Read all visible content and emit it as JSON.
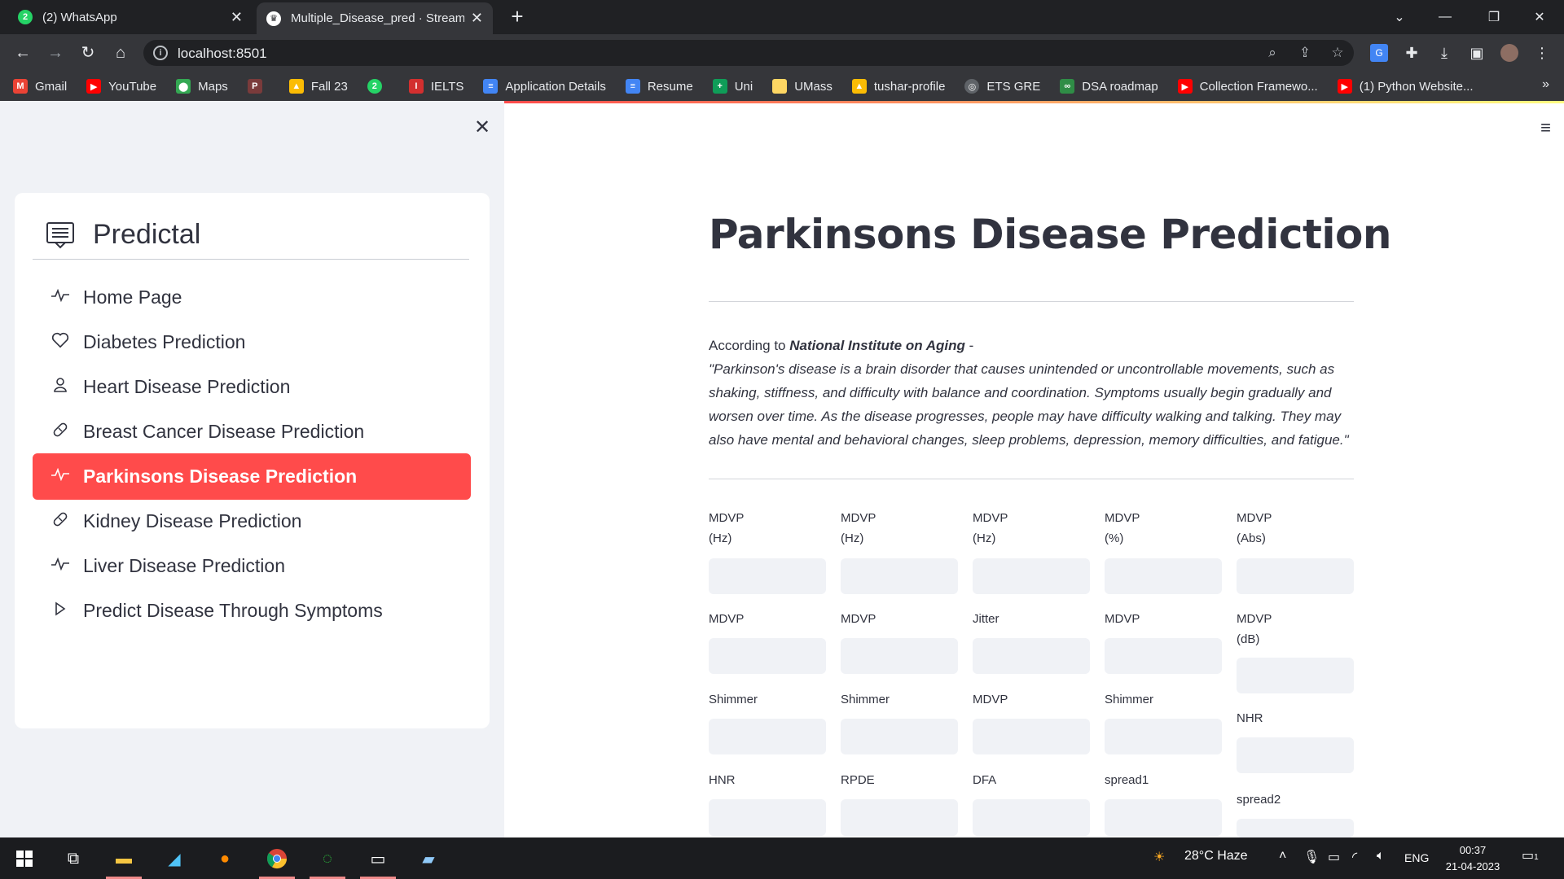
{
  "browser": {
    "tabs": [
      {
        "title": "(2) WhatsApp",
        "icon": "whatsapp-icon",
        "active": false
      },
      {
        "title": "Multiple_Disease_pred · Streamlit",
        "icon": "streamlit-icon",
        "active": true
      }
    ],
    "url": "localhost:8501",
    "bookmarks": [
      {
        "label": "Gmail",
        "icon": "gmail-icon",
        "color": "#ea4335"
      },
      {
        "label": "YouTube",
        "icon": "youtube-icon",
        "color": "#ff0000"
      },
      {
        "label": "Maps",
        "icon": "maps-icon",
        "color": "#34a853"
      },
      {
        "label": "",
        "icon": "pr-icon",
        "color": "#c0392b"
      },
      {
        "label": "Fall 23",
        "icon": "drive-icon",
        "color": "#fbbc04"
      },
      {
        "label": "",
        "icon": "whatsapp-icon",
        "color": "#25d366"
      },
      {
        "label": "IELTS",
        "icon": "ielts-icon",
        "color": "#d32f2f"
      },
      {
        "label": "Application Details",
        "icon": "docs-icon",
        "color": "#4285f4"
      },
      {
        "label": "Resume",
        "icon": "docs-icon",
        "color": "#4285f4"
      },
      {
        "label": "Uni",
        "icon": "sheets-icon",
        "color": "#0f9d58"
      },
      {
        "label": "UMass",
        "icon": "folder-icon",
        "color": "#fdd663"
      },
      {
        "label": "tushar-profile",
        "icon": "drive-icon",
        "color": "#fbbc04"
      },
      {
        "label": "ETS GRE",
        "icon": "globe-icon",
        "color": "#e8eaed"
      },
      {
        "label": "DSA roadmap",
        "icon": "gfg-icon",
        "color": "#2f8d46"
      },
      {
        "label": "Collection Framewo...",
        "icon": "youtube-icon",
        "color": "#ff0000"
      },
      {
        "label": "(1) Python Website...",
        "icon": "youtube-icon",
        "color": "#ff0000"
      }
    ]
  },
  "sidebar": {
    "title": "Predictal",
    "items": [
      {
        "label": "Home Page",
        "icon": "activity-icon",
        "symbol": "⟋",
        "active": false
      },
      {
        "label": "Diabetes Prediction",
        "icon": "heart-icon",
        "symbol": "♡",
        "active": false
      },
      {
        "label": "Heart Disease Prediction",
        "icon": "person-icon",
        "symbol": "⚇",
        "active": false
      },
      {
        "label": "Breast Cancer Disease Prediction",
        "icon": "bandaid-icon",
        "symbol": "⊘",
        "active": false
      },
      {
        "label": "Parkinsons Disease Prediction",
        "icon": "activity-icon",
        "symbol": "⟋",
        "active": true
      },
      {
        "label": "Kidney Disease Prediction",
        "icon": "bandaid-icon",
        "symbol": "⊘",
        "active": false
      },
      {
        "label": "Liver Disease Prediction",
        "icon": "activity-icon",
        "symbol": "⟋",
        "active": false
      },
      {
        "label": "Predict Disease Through Symptoms",
        "icon": "play-icon",
        "symbol": "▷",
        "active": false
      }
    ]
  },
  "main": {
    "title": "Parkinsons Disease Prediction",
    "intro_prefix": "According to ",
    "intro_source": "National Institute on Aging",
    "intro_suffix": " -",
    "quote": "\"Parkinson's disease is a brain disorder that causes unintended or uncontrollable movements, such as shaking, stiffness, and difficulty with balance and coordination. Symptoms usually begin gradually and worsen over time. As the disease progresses, people may have difficulty walking and talking. They may also have mental and behavioral changes, sleep problems, depression, memory difficulties, and fatigue.\"",
    "fields": [
      {
        "label1": "MDVP",
        "label2": "(Hz)"
      },
      {
        "label1": "MDVP",
        "label2": "(Hz)"
      },
      {
        "label1": "MDVP",
        "label2": "(Hz)"
      },
      {
        "label1": "MDVP",
        "label2": "(%)"
      },
      {
        "label1": "MDVP",
        "label2": "(Abs)"
      },
      {
        "label1": "MDVP",
        "label2": ""
      },
      {
        "label1": "MDVP",
        "label2": ""
      },
      {
        "label1": "Jitter",
        "label2": ""
      },
      {
        "label1": "MDVP",
        "label2": ""
      },
      {
        "label1": "MDVP",
        "label2": "(dB)"
      },
      {
        "label1": "Shimmer",
        "label2": ""
      },
      {
        "label1": "Shimmer",
        "label2": ""
      },
      {
        "label1": "MDVP",
        "label2": ""
      },
      {
        "label1": "Shimmer",
        "label2": ""
      },
      {
        "label1": "NHR",
        "label2": ""
      },
      {
        "label1": "HNR",
        "label2": ""
      },
      {
        "label1": "RPDE",
        "label2": ""
      },
      {
        "label1": "DFA",
        "label2": ""
      },
      {
        "label1": "spread1",
        "label2": ""
      },
      {
        "label1": "spread2",
        "label2": ""
      }
    ]
  },
  "taskbar": {
    "weather": "28°C  Haze",
    "language": "ENG",
    "time": "00:37",
    "date": "21-04-2023",
    "notification_count": "1"
  },
  "colors": {
    "accent": "#ff4b4b",
    "sidebar_bg": "#f0f2f6",
    "text": "#31333f"
  }
}
